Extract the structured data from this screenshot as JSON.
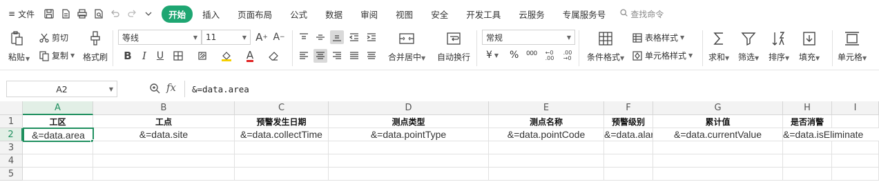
{
  "menubar": {
    "file_label": "文件",
    "tabs": [
      "开始",
      "插入",
      "页面布局",
      "公式",
      "数据",
      "审阅",
      "视图",
      "安全",
      "开发工具",
      "云服务",
      "专属服务号"
    ],
    "active_tab": "开始",
    "search_label": "查找命令"
  },
  "ribbon": {
    "paste": "粘贴",
    "cut": "剪切",
    "copy": "复制",
    "format_painter": "格式刷",
    "font_name": "等线",
    "font_size": "11",
    "merge_center": "合并居中",
    "wrap_text": "自动换行",
    "number_format": "常规",
    "currency_symbol": "¥",
    "percent_symbol": "%",
    "thousands_symbol": "000",
    "conditional_format": "条件格式",
    "table_style": "表格样式",
    "cell_style": "单元格样式",
    "sum": "求和",
    "filter": "筛选",
    "sort": "排序",
    "fill": "填充",
    "cell": "单元格"
  },
  "formula_bar": {
    "name_box": "A2",
    "fx": "fx",
    "content": "&=data.area"
  },
  "sheet": {
    "columns": [
      "A",
      "B",
      "C",
      "D",
      "E",
      "F",
      "G",
      "H",
      "I"
    ],
    "rows": [
      "1",
      "2",
      "3",
      "4",
      "5"
    ],
    "headers": [
      "工区",
      "工点",
      "预警发生日期",
      "测点类型",
      "测点名称",
      "预警级别",
      "累计值",
      "是否消警"
    ],
    "values": [
      "&=data.area",
      "&=data.site",
      "&=data.collectTime",
      "&=data.pointType",
      "&=data.pointCode",
      "&=data.alarmLevel",
      "&=data.currentValue",
      "&=data.isEliminate"
    ]
  },
  "colors": {
    "accent": "#1ea672",
    "selection": "#1e8f5e"
  }
}
